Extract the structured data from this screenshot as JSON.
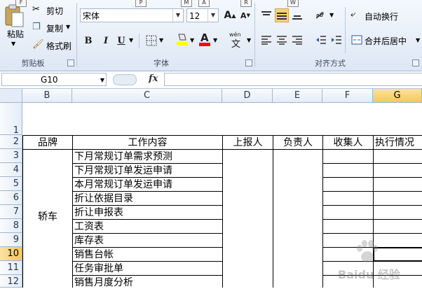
{
  "keytips": [
    "F",
    "P",
    "M",
    "A",
    "R",
    "W"
  ],
  "clipboard": {
    "paste_label": "粘贴",
    "cut_label": "剪切",
    "copy_label": "复制",
    "format_painter_label": "格式刷",
    "group_label": "剪贴板"
  },
  "font": {
    "font_name": "宋体",
    "font_size": "12",
    "grow_label": "A",
    "shrink_label": "A",
    "bold": "B",
    "italic": "I",
    "underline": "U",
    "color_label": "A",
    "wen_label": "wén",
    "group_label": "字体",
    "font_color": "#ff0000",
    "highlight_color": "#ffff00"
  },
  "alignment": {
    "wrap_text_label": "自动换行",
    "merge_center_label": "合并后居中",
    "group_label": "对齐方式"
  },
  "formula_bar": {
    "name_box": "G10",
    "fx_label": "fx",
    "content": ""
  },
  "grid": {
    "columns": [
      "B",
      "C",
      "D",
      "E",
      "F",
      "G"
    ],
    "selected_column": "G",
    "rows": [
      "1",
      "2",
      "3",
      "4",
      "5",
      "6",
      "7",
      "8",
      "9",
      "10",
      "11",
      "12"
    ],
    "selected_row": "10",
    "headers": {
      "brand": "品牌",
      "work_content": "工作内容",
      "reporter": "上报人",
      "owner": "负责人",
      "collector": "收集人",
      "execution": "执行情况"
    },
    "brand_value": "轿车",
    "tasks": [
      "下月常规订单需求预测",
      "下月常规订单发运申请",
      "本月常规订单发运申请",
      "折让依据目录",
      "折让申报表",
      "工资表",
      "库存表",
      "销售台帐",
      "任务审批单",
      "销售月度分析"
    ]
  },
  "watermark": "Baidu 经验"
}
